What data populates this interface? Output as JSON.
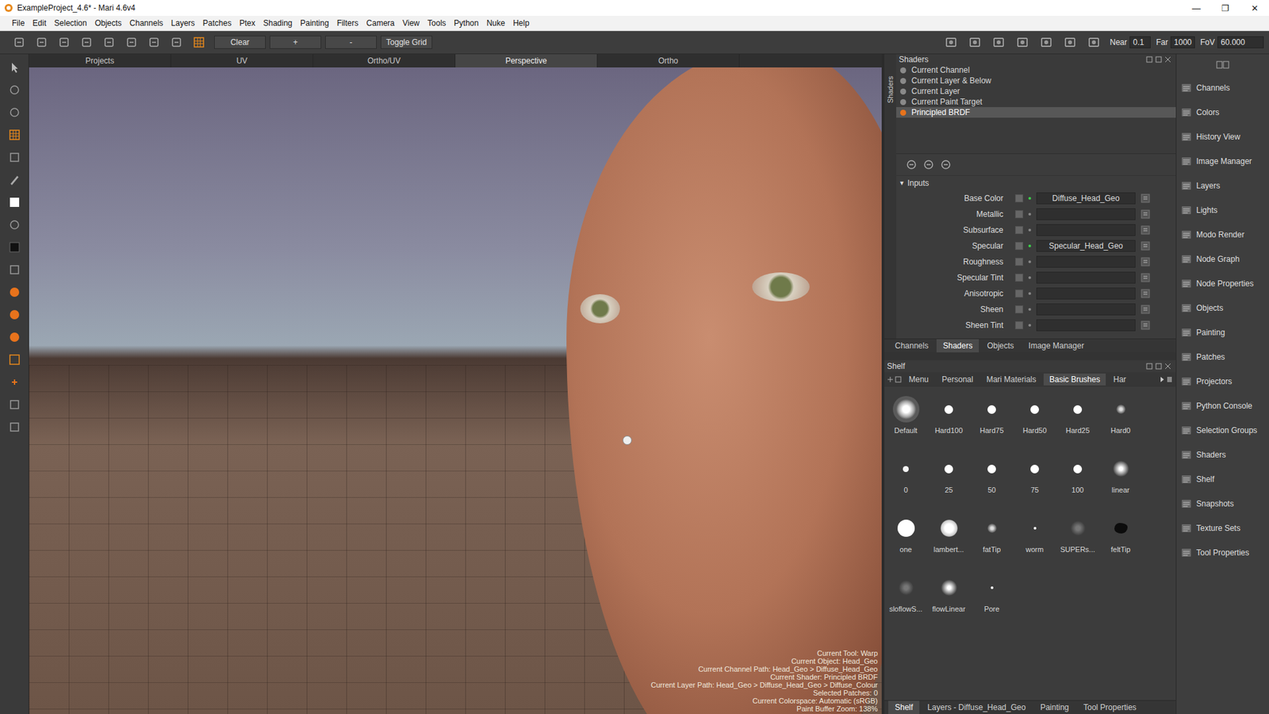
{
  "window": {
    "title": "ExampleProject_4.6* - Mari 4.6v4",
    "controls": [
      "—",
      "❐",
      "✕"
    ]
  },
  "menu": [
    "File",
    "Edit",
    "Selection",
    "Objects",
    "Channels",
    "Layers",
    "Patches",
    "Ptex",
    "Shading",
    "Painting",
    "Filters",
    "Camera",
    "View",
    "Tools",
    "Python",
    "Nuke",
    "Help"
  ],
  "toolbar": {
    "buttons": [
      "Clear",
      "+",
      "-",
      "Toggle Grid"
    ],
    "fields": [
      {
        "label": "Near",
        "value": "0.1"
      },
      {
        "label": "Far",
        "value": "1000"
      },
      {
        "label": "FoV",
        "value": "60.000"
      }
    ]
  },
  "view_tabs": [
    {
      "label": "Projects",
      "selected": false
    },
    {
      "label": "UV",
      "selected": false
    },
    {
      "label": "Ortho/UV",
      "selected": false
    },
    {
      "label": "Perspective",
      "selected": true
    },
    {
      "label": "Ortho",
      "selected": false
    }
  ],
  "hud": [
    "Current Tool: Warp",
    "Current Object: Head_Geo",
    "Current Channel Path: Head_Geo > Diffuse_Head_Geo",
    "Current Shader: Principled BRDF",
    "Current Layer Path: Head_Geo > Diffuse_Head_Geo > Diffuse_Colour",
    "Selected Patches: 0",
    "Current Colorspace: Automatic (sRGB)",
    "Paint Buffer Zoom: 138%"
  ],
  "shaders_panel": {
    "title": "Shaders",
    "side_tab": "Shaders",
    "items": [
      {
        "label": "Current Channel",
        "selected": false,
        "color": "#8a8a8a"
      },
      {
        "label": "Current Layer & Below",
        "selected": false,
        "color": "#8a8a8a"
      },
      {
        "label": "Current Layer",
        "selected": false,
        "color": "#8a8a8a"
      },
      {
        "label": "Current Paint Target",
        "selected": false,
        "color": "#8a8a8a"
      },
      {
        "label": "Principled BRDF",
        "selected": true,
        "color": "#e8731c"
      }
    ],
    "inputs": {
      "label": "Inputs",
      "arrow": "▼",
      "expanded": true,
      "rows": [
        {
          "label": "Base Color",
          "connected": true,
          "value": "Diffuse_Head_Geo"
        },
        {
          "label": "Metallic",
          "connected": false,
          "value": ""
        },
        {
          "label": "Subsurface",
          "connected": false,
          "value": ""
        },
        {
          "label": "Specular",
          "connected": true,
          "value": "Specular_Head_Geo"
        },
        {
          "label": "Roughness",
          "connected": false,
          "value": ""
        },
        {
          "label": "Specular Tint",
          "connected": false,
          "value": ""
        },
        {
          "label": "Anisotropic",
          "connected": false,
          "value": ""
        },
        {
          "label": "Sheen",
          "connected": false,
          "value": ""
        },
        {
          "label": "Sheen Tint",
          "connected": false,
          "value": ""
        }
      ]
    },
    "tabs": [
      {
        "label": "Channels",
        "selected": false
      },
      {
        "label": "Shaders",
        "selected": true
      },
      {
        "label": "Objects",
        "selected": false
      },
      {
        "label": "Image Manager",
        "selected": false
      }
    ]
  },
  "shelf": {
    "title": "Shelf",
    "tabs": [
      {
        "label": "Menu",
        "selected": false
      },
      {
        "label": "Personal",
        "selected": false
      },
      {
        "label": "Mari Materials",
        "selected": false
      },
      {
        "label": "Basic Brushes",
        "selected": true
      },
      {
        "label": "Har",
        "selected": false
      }
    ],
    "brushes": [
      {
        "label": "Default",
        "kind": "glow",
        "selected": true
      },
      {
        "label": "Hard100",
        "kind": "hard",
        "selected": false
      },
      {
        "label": "Hard75",
        "kind": "hard",
        "selected": false
      },
      {
        "label": "Hard50",
        "kind": "hard",
        "selected": false
      },
      {
        "label": "Hard25",
        "kind": "hard",
        "selected": false
      },
      {
        "label": "Hard0",
        "kind": "fattip",
        "selected": false
      },
      {
        "label": "0",
        "kind": "small",
        "selected": false
      },
      {
        "label": "25",
        "kind": "hard",
        "selected": false
      },
      {
        "label": "50",
        "kind": "hard",
        "selected": false
      },
      {
        "label": "75",
        "kind": "hard",
        "selected": false
      },
      {
        "label": "100",
        "kind": "hard",
        "selected": false
      },
      {
        "label": "linear",
        "kind": "soft",
        "selected": false
      },
      {
        "label": "one",
        "kind": "large",
        "selected": false
      },
      {
        "label": "lambert...",
        "kind": "softlarge",
        "selected": false
      },
      {
        "label": "fatTip",
        "kind": "fattip",
        "selected": false
      },
      {
        "label": "worm",
        "kind": "tiny",
        "selected": false
      },
      {
        "label": "SUPERs...",
        "kind": "faint",
        "selected": false
      },
      {
        "label": "feltTip",
        "kind": "splat",
        "selected": false
      },
      {
        "label": "sloflowS...",
        "kind": "faint",
        "selected": false
      },
      {
        "label": "flowLinear",
        "kind": "soft",
        "selected": false
      },
      {
        "label": "Pore",
        "kind": "tiny",
        "selected": false
      }
    ],
    "bottom_tabs": [
      {
        "label": "Shelf",
        "selected": true
      },
      {
        "label": "Layers - Diffuse_Head_Geo",
        "selected": false
      },
      {
        "label": "Painting",
        "selected": false
      },
      {
        "label": "Tool Properties",
        "selected": false
      }
    ]
  },
  "palettes": [
    "Channels",
    "Colors",
    "History View",
    "Image Manager",
    "Layers",
    "Lights",
    "Modo Render",
    "Node Graph",
    "Node Properties",
    "Objects",
    "Painting",
    "Patches",
    "Projectors",
    "Python Console",
    "Selection Groups",
    "Shaders",
    "Shelf",
    "Snapshots",
    "Texture Sets",
    "Tool Properties"
  ]
}
